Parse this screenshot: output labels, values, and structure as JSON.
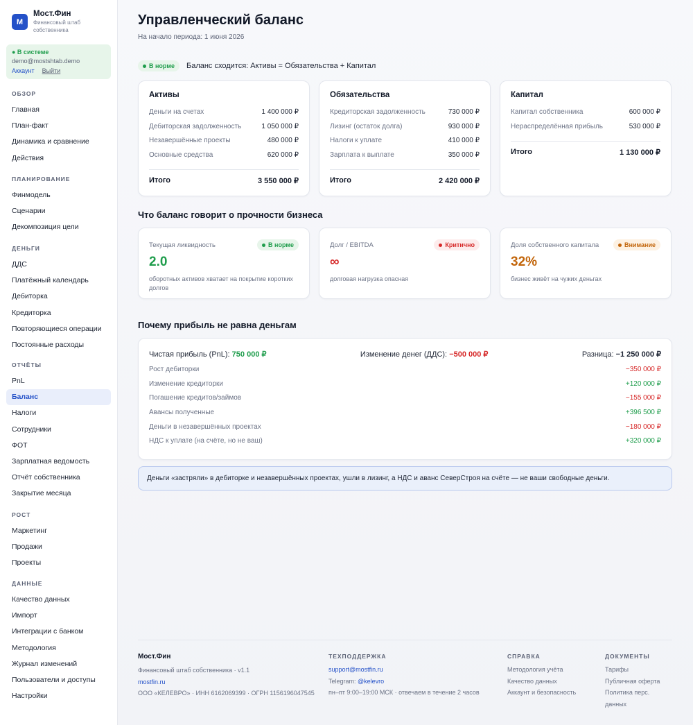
{
  "brand": {
    "logo_letter": "М",
    "name": "Мост.Фин",
    "tagline": "Финансовый штаб собственника"
  },
  "user": {
    "status": "● В системе",
    "email": "demo@mostshtab.demo",
    "account_link": "Аккаунт",
    "logout_link": "Выйти"
  },
  "nav": [
    {
      "section": "ОБЗОР",
      "items": [
        "Главная",
        "План-факт",
        "Динамика и сравнение",
        "Действия"
      ]
    },
    {
      "section": "ПЛАНИРОВАНИЕ",
      "items": [
        "Финмодель",
        "Сценарии",
        "Декомпозиция цели"
      ]
    },
    {
      "section": "ДЕНЬГИ",
      "items": [
        "ДДС",
        "Платёжный календарь",
        "Дебиторка",
        "Кредиторка",
        "Повторяющиеся операции",
        "Постоянные расходы"
      ]
    },
    {
      "section": "ОТЧЁТЫ",
      "items": [
        "PnL",
        "Баланс",
        "Налоги",
        "Сотрудники",
        "ФОТ",
        "Зарплатная ведомость",
        "Отчёт собственника",
        "Закрытие месяца"
      ]
    },
    {
      "section": "РОСТ",
      "items": [
        "Маркетинг",
        "Продажи",
        "Проекты"
      ]
    },
    {
      "section": "ДАННЫЕ",
      "items": [
        "Качество данных",
        "Импорт",
        "Интеграции с банком",
        "Методология",
        "Журнал изменений",
        "Пользователи и доступы",
        "Настройки"
      ]
    }
  ],
  "active_nav": "Баланс",
  "page": {
    "title": "Управленческий баланс",
    "subtitle": "На начало периода: 1 июня 2026",
    "status_pill": "В норме",
    "status_text": "Баланс сходится: Активы = Обязательства + Капитал"
  },
  "balance": {
    "assets": {
      "title": "Активы",
      "rows": [
        {
          "label": "Деньги на счетах",
          "value": "1 400 000 ₽"
        },
        {
          "label": "Дебиторская задолженность",
          "value": "1 050 000 ₽"
        },
        {
          "label": "Незавершённые проекты",
          "value": "480 000 ₽"
        },
        {
          "label": "Основные средства",
          "value": "620 000 ₽"
        }
      ],
      "total_label": "Итого",
      "total": "3 550 000 ₽"
    },
    "liabilities": {
      "title": "Обязательства",
      "rows": [
        {
          "label": "Кредиторская задолженность",
          "value": "730 000 ₽"
        },
        {
          "label": "Лизинг (остаток долга)",
          "value": "930 000 ₽"
        },
        {
          "label": "Налоги к уплате",
          "value": "410 000 ₽"
        },
        {
          "label": "Зарплата к выплате",
          "value": "350 000 ₽"
        }
      ],
      "total_label": "Итого",
      "total": "2 420 000 ₽"
    },
    "equity": {
      "title": "Капитал",
      "rows": [
        {
          "label": "Капитал собственника",
          "value": "600 000 ₽"
        },
        {
          "label": "Нераспределённая прибыль",
          "value": "530 000 ₽"
        }
      ],
      "total_label": "Итого",
      "total": "1 130 000 ₽"
    }
  },
  "strength": {
    "title": "Что баланс говорит о прочности бизнеса",
    "metrics": [
      {
        "label": "Текущая ликвидность",
        "badge": "В норме",
        "badge_kind": "ok",
        "value": "2.0",
        "value_color": "#1f9d4c",
        "desc": "оборотных активов хватает на покрытие коротких долгов"
      },
      {
        "label": "Долг / EBITDA",
        "badge": "Критично",
        "badge_kind": "bad",
        "value": "∞",
        "value_color": "#d62828",
        "desc": "долговая нагрузка опасная"
      },
      {
        "label": "Доля собственного капитала",
        "badge": "Внимание",
        "badge_kind": "warn",
        "value": "32%",
        "value_color": "#c2650a",
        "desc": "бизнес живёт на чужих деньгах"
      }
    ]
  },
  "profit": {
    "title": "Почему прибыль не равна деньгам",
    "pnl_label": "Чистая прибыль (PnL):",
    "pnl_value": "750 000 ₽",
    "cash_label": "Изменение денег (ДДС):",
    "cash_value": "−500 000 ₽",
    "diff_label": "Разница:",
    "diff_value": "−1 250 000 ₽",
    "rows": [
      {
        "label": "Рост дебиторки",
        "value": "−350 000 ₽",
        "sign": "neg"
      },
      {
        "label": "Изменение кредиторки",
        "value": "+120 000 ₽",
        "sign": "pos"
      },
      {
        "label": "Погашение кредитов/займов",
        "value": "−155 000 ₽",
        "sign": "neg"
      },
      {
        "label": "Авансы полученные",
        "value": "+396 500 ₽",
        "sign": "pos"
      },
      {
        "label": "Деньги в незавершённых проектах",
        "value": "−180 000 ₽",
        "sign": "neg"
      },
      {
        "label": "НДС к уплате (на счёте, но не ваш)",
        "value": "+320 000 ₽",
        "sign": "pos"
      }
    ],
    "note": "Деньги «застряли» в дебиторке и незавершённых проектах, ушли в лизинг, а НДС и аванс СеверСтроя на счёте — не ваши свободные деньги."
  },
  "footer": {
    "brand": "Мост.Фин",
    "version": "Финансовый штаб собственника · v1.1",
    "site": "mostfin.ru",
    "legal": "ООО «КЕЛЕВРО» · ИНН 6162069399 · ОГРН 1156196047545",
    "support_head": "ТЕХПОДДЕРЖКА",
    "support_email": "support@mostfin.ru",
    "telegram_label": "Telegram:",
    "telegram_handle": "@kelevro",
    "hours": "пн–пт 9:00–19:00 МСК · отвечаем в течение 2 часов",
    "help_head": "СПРАВКА",
    "help_links": [
      "Методология учёта",
      "Качество данных",
      "Аккаунт и безопасность"
    ],
    "docs_head": "ДОКУМЕНТЫ",
    "docs_links": [
      "Тарифы",
      "Публичная оферта",
      "Политика перс. данных"
    ]
  }
}
